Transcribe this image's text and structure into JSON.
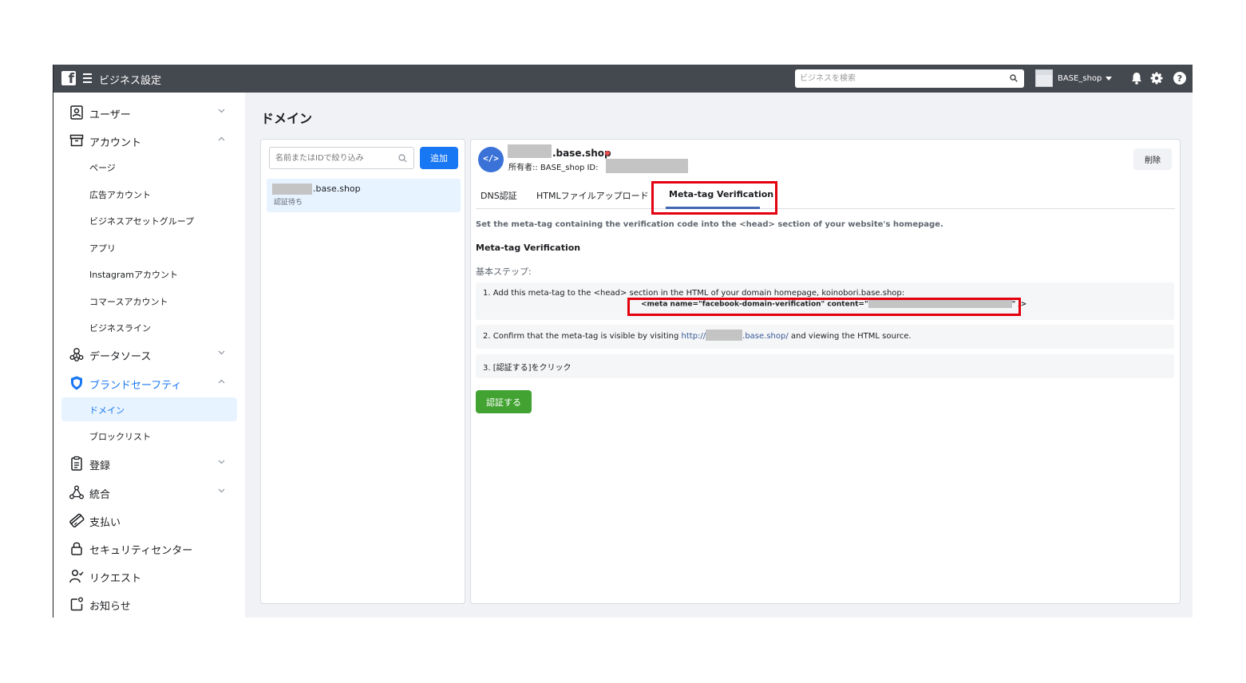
{
  "topbar": {
    "title": "ビジネス設定",
    "search_placeholder": "ビジネスを検索",
    "account_name": "BASE_shop",
    "icons": [
      "facebook-logo",
      "menu-icon",
      "search-icon",
      "bell-icon",
      "gear-icon",
      "help-icon"
    ]
  },
  "sidebar": {
    "users": "ユーザー",
    "accounts": "アカウント",
    "pages": "ページ",
    "ad_accounts": "広告アカウント",
    "asset_groups": "ビジネスアセットグループ",
    "apps": "アプリ",
    "instagram": "Instagramアカウント",
    "commerce": "コマースアカウント",
    "business_line": "ビジネスライン",
    "data_sources": "データソース",
    "brand_safety": "ブランドセーフティ",
    "domains": "ドメイン",
    "block_lists": "ブロックリスト",
    "registration": "登録",
    "integrations": "統合",
    "payments": "支払い",
    "security_center": "セキュリティセンター",
    "requests": "リクエスト",
    "notifications": "お知らせ"
  },
  "page": {
    "title": "ドメイン"
  },
  "domain_list": {
    "filter_placeholder": "名前またはIDで絞り込み",
    "add_label": "追加",
    "item": {
      "name_suffix": ".base.shop",
      "status": "認証待ち"
    }
  },
  "detail": {
    "domain_suffix": ".base.shop",
    "owner_label": "所有者:: BASE_shop  ID:",
    "delete_label": "削除",
    "tabs": [
      "DNS認証",
      "HTMLファイルアップロード",
      "Meta-tag Verification"
    ],
    "intro": "Set the meta-tag containing the verification code into the <head> section of your website's homepage.",
    "section_title": "Meta-tag Verification",
    "steps_label": "基本ステップ:",
    "step1": "1. Add this meta-tag to the <head> section in the HTML of your domain homepage, koinobori.base.shop:",
    "step1_code_prefix": "<meta name=\"facebook-domain-verification\" content=\"",
    "step1_code_suffix": "\" />",
    "step2_prefix": "2. Confirm that the meta-tag is visible by visiting ",
    "step2_link_prefix": "http://",
    "step2_link_suffix": ".base.shop/",
    "step2_suffix": " and viewing the HTML source.",
    "step3": "3. [認証する]をクリック",
    "verify_label": "認証する"
  },
  "colors": {
    "topbar": "#44484f",
    "primary": "#1877f2",
    "verify": "#42a332",
    "highlight": "#e3000f"
  }
}
